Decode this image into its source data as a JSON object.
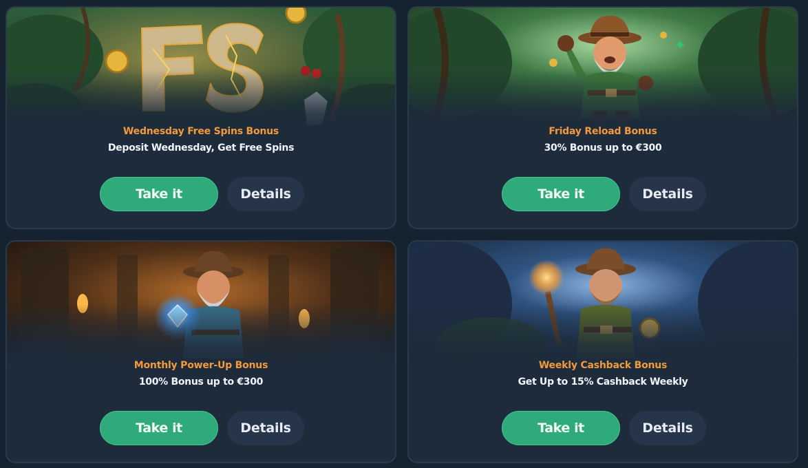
{
  "colors": {
    "background": "#15222f",
    "card": "#1d2b3b",
    "title_accent": "#f49a3c",
    "take_button": "#2eaa7b",
    "details_button": "#26354a"
  },
  "cards": [
    {
      "title": "Wednesday Free Spins Bonus",
      "subtitle": "Deposit Wednesday, Get Free Spins",
      "take_label": "Take it",
      "details_label": "Details",
      "image": "free-spins-stone-letters-jungle",
      "image_text": "FS"
    },
    {
      "title": "Friday Reload Bonus",
      "subtitle": "30% Bonus up to €300",
      "take_label": "Take it",
      "details_label": "Details",
      "image": "explorer-cheering-jungle"
    },
    {
      "title": "Monthly Power-Up Bonus",
      "subtitle": "100% Bonus up to €300",
      "take_label": "Take it",
      "details_label": "Details",
      "image": "explorer-holding-diamond-temple"
    },
    {
      "title": "Weekly Cashback Bonus",
      "subtitle": "Get Up to 15% Cashback Weekly",
      "take_label": "Take it",
      "details_label": "Details",
      "image": "explorer-torch-compass-cave"
    }
  ]
}
